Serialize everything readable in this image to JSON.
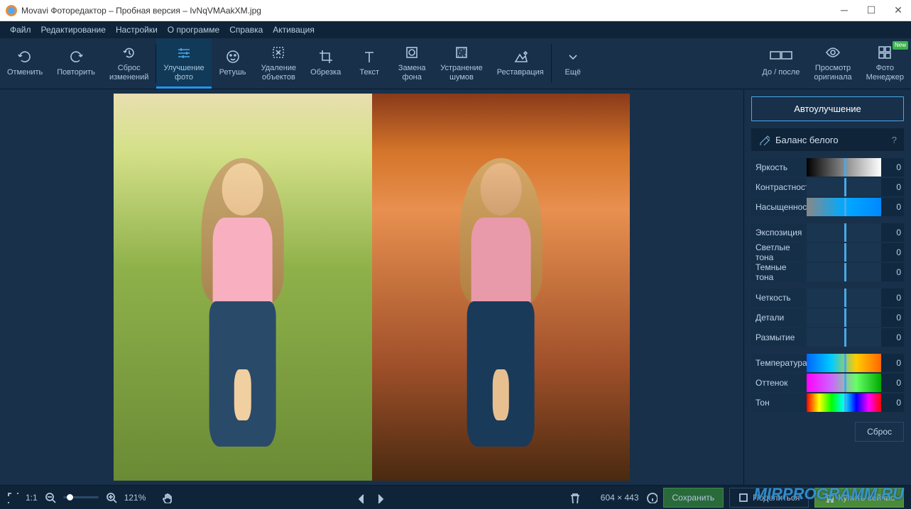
{
  "title": "Movavi Фоторедактор – Пробная версия – IvNqVMAakXM.jpg",
  "menu": [
    "Файл",
    "Редактирование",
    "Настройки",
    "О программе",
    "Справка",
    "Активация"
  ],
  "toolbar": {
    "undo": "Отменить",
    "redo": "Повторить",
    "reset": "Сброс\nизменений",
    "enhance": "Улучшение\nфото",
    "retouch": "Ретушь",
    "remove": "Удаление\nобъектов",
    "crop": "Обрезка",
    "text": "Текст",
    "bgswap": "Замена\nфона",
    "denoise": "Устранение\nшумов",
    "restore": "Реставрация",
    "more": "Ещё",
    "beforeafter": "До / после",
    "vieworig": "Просмотр\nоригинала",
    "manager": "Фото\nМенеджер",
    "newbadge": "New"
  },
  "panel": {
    "auto": "Автоулучшение",
    "wb": "Баланс белого",
    "sliders": {
      "brightness": {
        "label": "Яркость",
        "value": "0"
      },
      "contrast": {
        "label": "Контрастность",
        "value": "0"
      },
      "saturation": {
        "label": "Насыщенность",
        "value": "0"
      },
      "exposure": {
        "label": "Экспозиция",
        "value": "0"
      },
      "highlights": {
        "label": "Светлые тона",
        "value": "0"
      },
      "shadows": {
        "label": "Темные тона",
        "value": "0"
      },
      "sharpness": {
        "label": "Четкость",
        "value": "0"
      },
      "details": {
        "label": "Детали",
        "value": "0"
      },
      "blur": {
        "label": "Размытие",
        "value": "0"
      },
      "temperature": {
        "label": "Температура",
        "value": "0"
      },
      "tint": {
        "label": "Оттенок",
        "value": "0"
      },
      "hue": {
        "label": "Тон",
        "value": "0"
      }
    },
    "reset": "Сброс"
  },
  "footer": {
    "zoom": "121%",
    "ratio": "1:1",
    "dims": "604 × 443",
    "save": "Сохранить",
    "share": "Поделиться",
    "buy": "Купить сейчас"
  },
  "watermark": "MIRPROGRAMM.RU"
}
